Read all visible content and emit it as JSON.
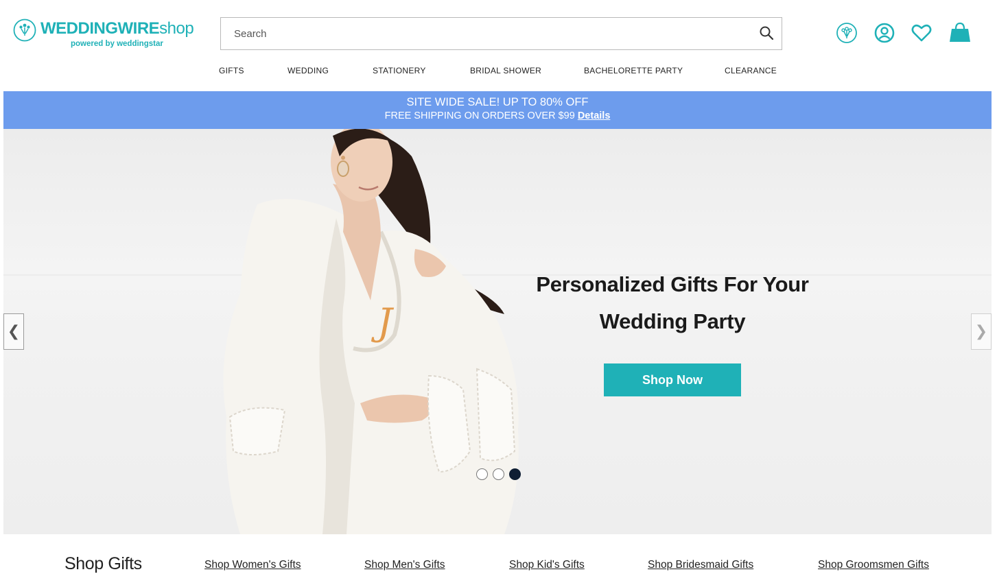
{
  "header": {
    "logo": {
      "brand_bold": "WEDDINGWIRE",
      "brand_light": "shop",
      "tagline": "powered by weddingstar"
    },
    "search": {
      "placeholder": "Search",
      "value": ""
    },
    "icons": [
      "bouquet-icon",
      "account-icon",
      "heart-icon",
      "shopping-bag-icon"
    ],
    "accent_color": "#1fb1b7"
  },
  "nav": {
    "items": [
      {
        "label": "GIFTS"
      },
      {
        "label": "WEDDING"
      },
      {
        "label": "STATIONERY"
      },
      {
        "label": "BRIDAL SHOWER"
      },
      {
        "label": "BACHELORETTE PARTY"
      },
      {
        "label": "CLEARANCE"
      }
    ]
  },
  "promo": {
    "line1": "SITE WIDE SALE! UP TO 80% OFF",
    "line2": "FREE SHIPPING ON ORDERS OVER $99",
    "details_link": "Details",
    "background": "#6d9ced"
  },
  "hero": {
    "headline_line1": "Personalized Gifts For Your",
    "headline_line2": "Wedding Party",
    "cta": "Shop Now",
    "monogram": "J",
    "prev_arrow": "❮",
    "next_arrow": "❯",
    "slides_total": 3,
    "active_slide": 3
  },
  "shop_gifts": {
    "title": "Shop Gifts",
    "links": [
      {
        "label": "Shop Women's Gifts"
      },
      {
        "label": "Shop Men's Gifts"
      },
      {
        "label": "Shop Kid's Gifts"
      },
      {
        "label": "Shop Bridesmaid Gifts"
      },
      {
        "label": "Shop Groomsmen Gifts"
      }
    ]
  }
}
